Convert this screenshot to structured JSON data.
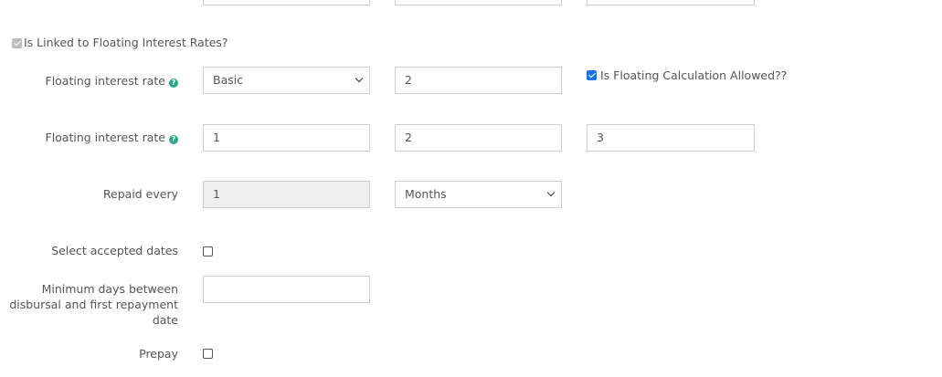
{
  "linked_floating": {
    "label": "Is Linked to Floating Interest Rates?",
    "checked": true
  },
  "floating_rate_row1": {
    "label": "Floating interest rate",
    "select_value": "Basic",
    "input_value": "2",
    "calc_allowed_label": "Is Floating Calculation Allowed??",
    "calc_allowed_checked": true
  },
  "floating_rate_row2": {
    "label": "Floating interest rate",
    "value1": "1",
    "value2": "2",
    "value3": "3"
  },
  "repaid_every": {
    "label": "Repaid every",
    "value": "1",
    "unit": "Months"
  },
  "accepted_dates": {
    "label": "Select accepted dates",
    "checked": false
  },
  "min_days": {
    "label_lines": [
      "Minimum days between",
      "disbursal and first repayment",
      "date"
    ],
    "value": ""
  },
  "prepay": {
    "label": "Prepay",
    "checked": false
  },
  "icons": {
    "help": "question-circle-icon"
  },
  "colors": {
    "accent": "#2aa889",
    "checkbox": "#1a73e8"
  }
}
